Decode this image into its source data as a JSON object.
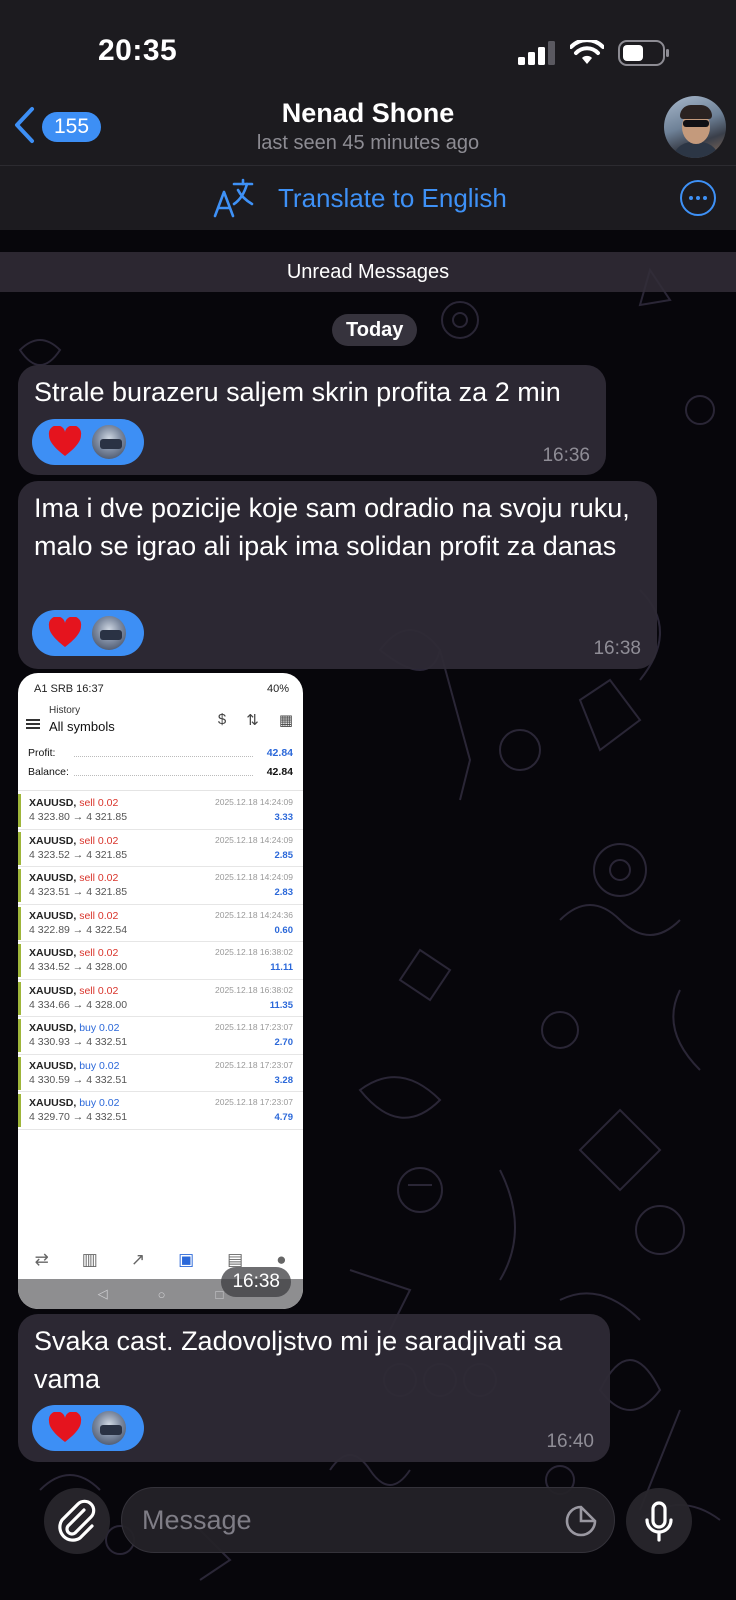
{
  "status_bar": {
    "time": "20:35"
  },
  "header": {
    "back_count": "155",
    "contact_name": "Nenad Shone",
    "contact_status": "last seen 45 minutes ago"
  },
  "translate_bar": {
    "label": "Translate to English"
  },
  "unread_label": "Unread Messages",
  "date_label": "Today",
  "messages": [
    {
      "text": "Strale burazeru saljem skrin profita za 2 min",
      "time": "16:36",
      "reaction": "heart"
    },
    {
      "text": "Ima i dve pozicije koje sam odradio na svoju ruku, malo se igrao ali ipak ima solidan profit za danas",
      "time": "16:38",
      "reaction": "heart"
    },
    {
      "text": "Svaka cast. Zadovoljstvo mi je saradjivati sa vama",
      "time": "16:40",
      "reaction": "heart"
    }
  ],
  "photo_message": {
    "time": "16:38",
    "screenshot": {
      "status_left": "A1 SRB 16:37",
      "status_right": "40%",
      "history_label": "History",
      "filter_label": "All symbols",
      "profit_label": "Profit:",
      "profit_value": "42.84",
      "balance_label": "Balance:",
      "balance_value": "42.84",
      "trades": [
        {
          "symbol": "XAUUSD,",
          "side": "sell 0.02",
          "type": "sell",
          "prices": "4 323.80 → 4 321.85",
          "datetime": "2025.12.18 14:24:09",
          "profit": "3.33"
        },
        {
          "symbol": "XAUUSD,",
          "side": "sell 0.02",
          "type": "sell",
          "prices": "4 323.52 → 4 321.85",
          "datetime": "2025.12.18 14:24:09",
          "profit": "2.85"
        },
        {
          "symbol": "XAUUSD,",
          "side": "sell 0.02",
          "type": "sell",
          "prices": "4 323.51 → 4 321.85",
          "datetime": "2025.12.18 14:24:09",
          "profit": "2.83"
        },
        {
          "symbol": "XAUUSD,",
          "side": "sell 0.02",
          "type": "sell",
          "prices": "4 322.89 → 4 322.54",
          "datetime": "2025.12.18 14:24:36",
          "profit": "0.60"
        },
        {
          "symbol": "XAUUSD,",
          "side": "sell 0.02",
          "type": "sell",
          "prices": "4 334.52 → 4 328.00",
          "datetime": "2025.12.18 16:38:02",
          "profit": "11.11"
        },
        {
          "symbol": "XAUUSD,",
          "side": "sell 0.02",
          "type": "sell",
          "prices": "4 334.66 → 4 328.00",
          "datetime": "2025.12.18 16:38:02",
          "profit": "11.35"
        },
        {
          "symbol": "XAUUSD,",
          "side": "buy 0.02",
          "type": "buy",
          "prices": "4 330.93 → 4 332.51",
          "datetime": "2025.12.18 17:23:07",
          "profit": "2.70"
        },
        {
          "symbol": "XAUUSD,",
          "side": "buy 0.02",
          "type": "buy",
          "prices": "4 330.59 → 4 332.51",
          "datetime": "2025.12.18 17:23:07",
          "profit": "3.28"
        },
        {
          "symbol": "XAUUSD,",
          "side": "buy 0.02",
          "type": "buy",
          "prices": "4 329.70 → 4 332.51",
          "datetime": "2025.12.18 17:23:07",
          "profit": "4.79"
        }
      ]
    }
  },
  "input_bar": {
    "placeholder": "Message"
  },
  "colors": {
    "accent": "#3d8ff5",
    "sell": "#d9342b",
    "buy": "#2b68d9",
    "trade_marker": "#9eb53a"
  },
  "icons": [
    "back-chevron-icon",
    "translate-icon",
    "more-icon",
    "heart-icon",
    "attach-icon",
    "sticker-icon",
    "mic-icon",
    "signal-icon",
    "wifi-icon",
    "battery-icon"
  ]
}
